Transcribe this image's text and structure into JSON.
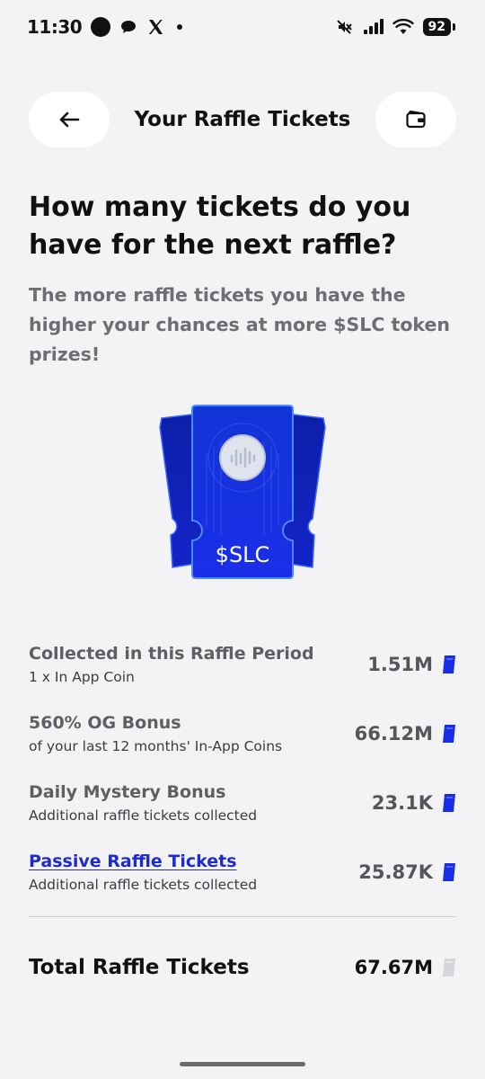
{
  "status_bar": {
    "time": "11:30",
    "battery": "92",
    "icons": [
      "record-dot-icon",
      "chat-bubble-icon",
      "x-logo-icon",
      "notification-dot-icon",
      "mute-icon",
      "signal-icon",
      "wifi-icon",
      "battery-icon"
    ]
  },
  "header": {
    "title": "Your Raffle Tickets",
    "back_icon": "arrow-left-icon",
    "wallet_icon": "wallet-icon"
  },
  "headline": "How many tickets do you have for the next raffle?",
  "subtext": "The more raffle tickets you have the higher your chances at more $SLC token prizes!",
  "ticket_art": {
    "label": "$SLC",
    "accent": "#1a2ee8"
  },
  "rows": [
    {
      "title": "Collected in this Raffle Period",
      "subtitle": "1 x In App Coin",
      "value": "1.51M",
      "link": false
    },
    {
      "title": "560% OG Bonus",
      "subtitle": "of your last 12 months' In-App Coins",
      "value": "66.12M",
      "link": false
    },
    {
      "title": "Daily Mystery Bonus",
      "subtitle": "Additional raffle tickets collected",
      "value": "23.1K",
      "link": false
    },
    {
      "title": "Passive Raffle Tickets",
      "subtitle": "Additional raffle tickets collected",
      "value": "25.87K",
      "link": true
    }
  ],
  "total": {
    "label": "Total Raffle Tickets",
    "value": "67.67M"
  },
  "colors": {
    "background": "#f3f3f6",
    "ticket_blue": "#1a2ee8",
    "link_blue": "#1f2bd0"
  }
}
